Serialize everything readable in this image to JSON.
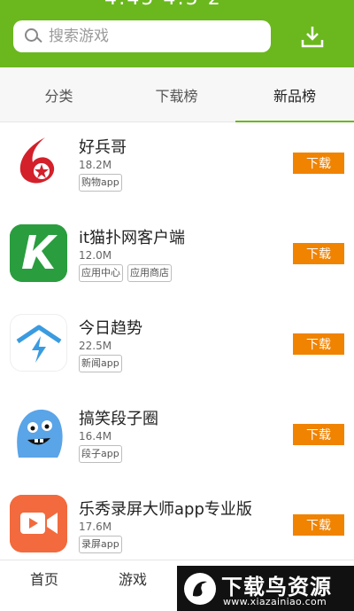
{
  "header": {
    "status_clip": "4:45 4:5 2",
    "search": {
      "placeholder": "搜索游戏"
    },
    "download_icon": "download-tray-icon"
  },
  "tabs": [
    {
      "label": "分类",
      "active": false
    },
    {
      "label": "下载榜",
      "active": false
    },
    {
      "label": "新品榜",
      "active": true
    }
  ],
  "apps": [
    {
      "name": "好兵哥",
      "size": "18.2M",
      "tags": [
        "购物app"
      ],
      "icon": "haobingge-app-icon",
      "download_label": "下载"
    },
    {
      "name": "it猫扑网客户端",
      "size": "12.0M",
      "tags": [
        "应用中心",
        "应用商店"
      ],
      "icon": "itmop-app-icon",
      "download_label": "下载"
    },
    {
      "name": "今日趋势",
      "size": "22.5M",
      "tags": [
        "新闻app"
      ],
      "icon": "trend-app-icon",
      "download_label": "下载"
    },
    {
      "name": "搞笑段子圈",
      "size": "16.4M",
      "tags": [
        "段子app"
      ],
      "icon": "funny-monster-app-icon",
      "download_label": "下载"
    },
    {
      "name": "乐秀录屏大师app专业版",
      "size": "17.6M",
      "tags": [
        "录屏app"
      ],
      "icon": "screen-recorder-app-icon",
      "download_label": "下载"
    }
  ],
  "bottom_nav": [
    {
      "label": "首页"
    },
    {
      "label": "游戏"
    }
  ],
  "watermark": {
    "title": "下载鸟资源",
    "url": "www.xiazainiao.com"
  },
  "colors": {
    "brand_green": "#6ab81e",
    "download_orange": "#f08300"
  }
}
